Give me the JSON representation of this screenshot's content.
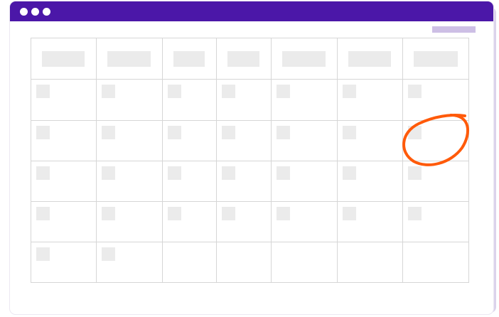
{
  "colors": {
    "titlebar": "#4b17a8",
    "window_dot": "#ffffff",
    "corner_pill": "#cdbfe5",
    "grid_line": "#d6d6d6",
    "placeholder": "#ebebeb",
    "annotation": "#ff5a0a"
  },
  "icons": [
    "window-dot-icon",
    "window-dot-icon",
    "window-dot-icon"
  ],
  "calendar": {
    "columns": 7,
    "rows": 5,
    "cells_with_placeholder": [
      [
        true,
        true,
        true,
        true,
        true,
        true,
        true
      ],
      [
        true,
        true,
        true,
        true,
        true,
        true,
        true
      ],
      [
        true,
        true,
        true,
        true,
        true,
        true,
        true
      ],
      [
        true,
        true,
        true,
        true,
        true,
        true,
        true
      ],
      [
        true,
        true,
        false,
        false,
        false,
        false,
        false
      ]
    ],
    "annotation": {
      "shape": "hand-drawn-circle",
      "row": 2,
      "column": 7
    }
  }
}
